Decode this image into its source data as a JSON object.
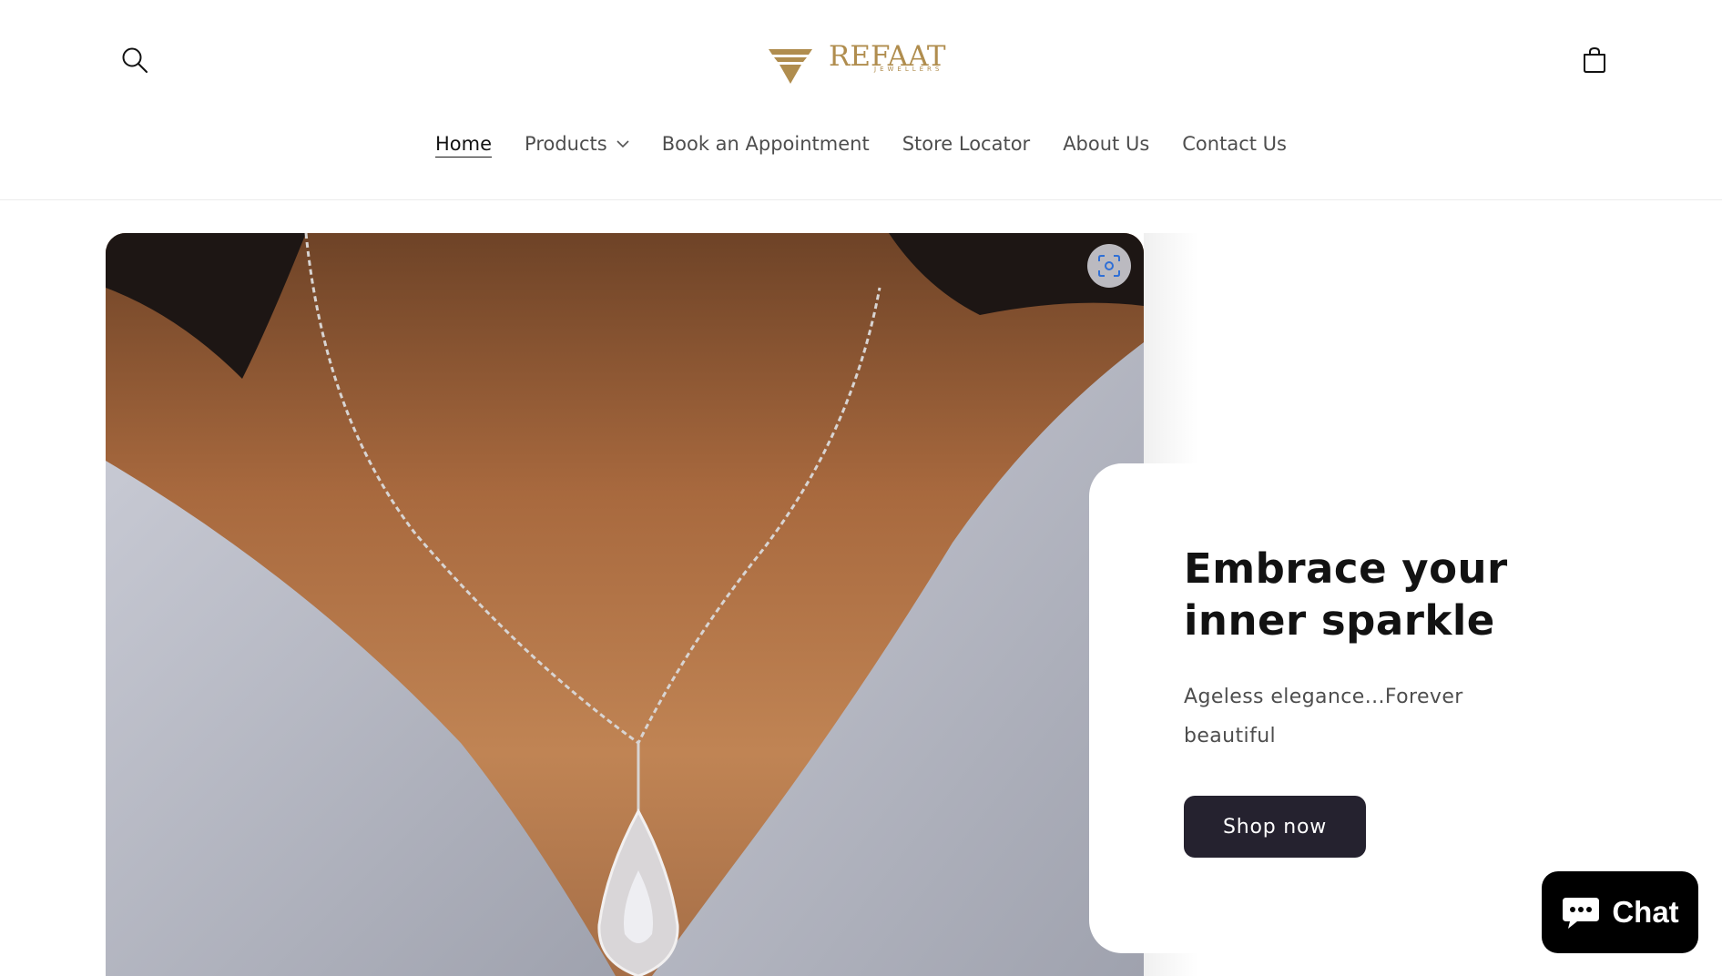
{
  "brand": {
    "name": "REFAAT",
    "tagline": "JEWELLERS",
    "color": "#b08d4e"
  },
  "header": {
    "search_icon": "search-icon",
    "cart_icon": "cart-icon"
  },
  "nav": {
    "items": [
      {
        "label": "Home",
        "active": true
      },
      {
        "label": "Products",
        "has_dropdown": true
      },
      {
        "label": "Book an Appointment"
      },
      {
        "label": "Store Locator"
      },
      {
        "label": "About Us"
      },
      {
        "label": "Contact Us"
      }
    ]
  },
  "hero": {
    "image": "woman-wearing-diamond-pendant-necklace",
    "lens_icon": "visual-search-icon",
    "title": "Embrace your inner sparkle",
    "subtitle": "Ageless elegance...Forever beautiful",
    "cta_label": "Shop now",
    "cta_color": "#25222f"
  },
  "chat": {
    "label": "Chat",
    "icon": "chat-bubble-icon",
    "bg_color": "#000000"
  }
}
